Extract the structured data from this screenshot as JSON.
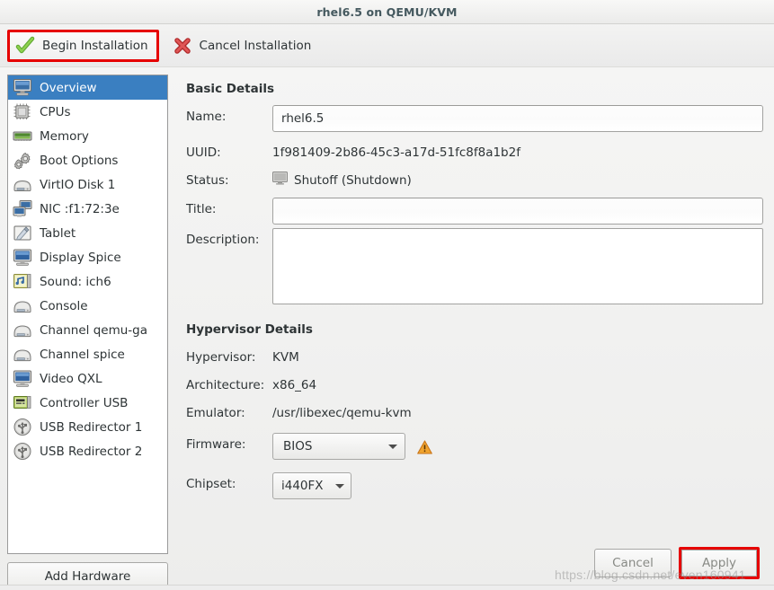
{
  "window": {
    "title": "rhel6.5 on QEMU/KVM"
  },
  "toolbar": {
    "begin_install_label": "Begin Installation",
    "cancel_install_label": "Cancel Installation",
    "begin_icon": "green-check-icon",
    "cancel_icon": "red-x-icon"
  },
  "sidebar": {
    "items": [
      {
        "label": "Overview",
        "icon": "computer-monitor-icon",
        "selected": true
      },
      {
        "label": "CPUs",
        "icon": "cpu-chip-icon",
        "selected": false
      },
      {
        "label": "Memory",
        "icon": "memory-stick-icon",
        "selected": false
      },
      {
        "label": "Boot Options",
        "icon": "gears-icon",
        "selected": false
      },
      {
        "label": "VirtIO Disk 1",
        "icon": "hard-disk-icon",
        "selected": false
      },
      {
        "label": "NIC :f1:72:3e",
        "icon": "network-card-icon",
        "selected": false
      },
      {
        "label": "Tablet",
        "icon": "tablet-pen-icon",
        "selected": false
      },
      {
        "label": "Display Spice",
        "icon": "display-icon",
        "selected": false
      },
      {
        "label": "Sound: ich6",
        "icon": "sound-card-icon",
        "selected": false
      },
      {
        "label": "Console",
        "icon": "serial-console-icon",
        "selected": false
      },
      {
        "label": "Channel qemu-ga",
        "icon": "serial-console-icon",
        "selected": false
      },
      {
        "label": "Channel spice",
        "icon": "serial-console-icon",
        "selected": false
      },
      {
        "label": "Video QXL",
        "icon": "display-icon",
        "selected": false
      },
      {
        "label": "Controller USB",
        "icon": "controller-card-icon",
        "selected": false
      },
      {
        "label": "USB Redirector 1",
        "icon": "usb-icon",
        "selected": false
      },
      {
        "label": "USB Redirector 2",
        "icon": "usb-icon",
        "selected": false
      }
    ],
    "add_hardware_label": "Add Hardware"
  },
  "basic_details": {
    "heading": "Basic Details",
    "name_label": "Name:",
    "name_value": "rhel6.5",
    "uuid_label": "UUID:",
    "uuid_value": "1f981409-2b86-45c3-a17d-51fc8f8a1b2f",
    "status_label": "Status:",
    "status_value": "Shutoff (Shutdown)",
    "status_icon": "shutoff-monitor-icon",
    "title_label": "Title:",
    "title_value": "",
    "description_label": "Description:",
    "description_value": ""
  },
  "hypervisor_details": {
    "heading": "Hypervisor Details",
    "hypervisor_label": "Hypervisor:",
    "hypervisor_value": "KVM",
    "architecture_label": "Architecture:",
    "architecture_value": "x86_64",
    "emulator_label": "Emulator:",
    "emulator_value": "/usr/libexec/qemu-kvm",
    "firmware_label": "Firmware:",
    "firmware_value": "BIOS",
    "firmware_warning_icon": "warning-triangle-icon",
    "chipset_label": "Chipset:",
    "chipset_value": "i440FX"
  },
  "footer": {
    "cancel_label": "Cancel",
    "apply_label": "Apply"
  },
  "watermark": {
    "text": "https://blog.csdn.net/even160941"
  },
  "colors": {
    "selection_blue": "#3a7fc1",
    "highlight_red": "#e60000",
    "window_bg": "#ededed",
    "title_text": "#45595f",
    "warning_orange": "#e8922a"
  }
}
